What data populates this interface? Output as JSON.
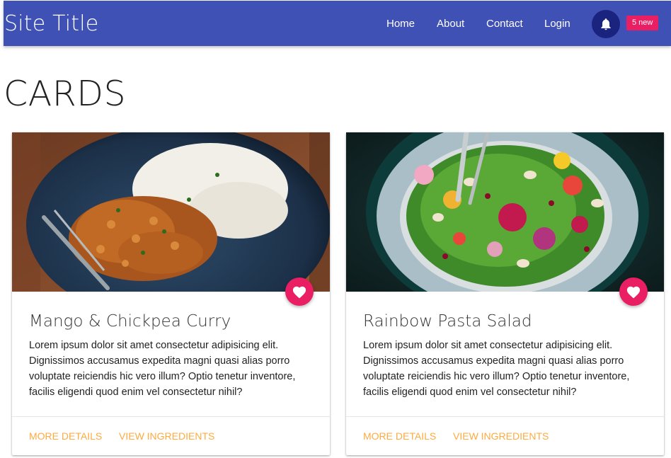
{
  "header": {
    "site_title": "Site Title",
    "nav": [
      {
        "label": "Home"
      },
      {
        "label": "About"
      },
      {
        "label": "Contact"
      },
      {
        "label": "Login"
      }
    ],
    "notification_icon": "bell-icon",
    "badge": "5 new"
  },
  "main": {
    "heading": "CARDS",
    "cards": [
      {
        "title": "Mango & Chickpea Curry",
        "text": "Lorem ipsum dolor sit amet consectetur adipisicing elit. Dignissimos accusamus expedita magni quasi alias porro voluptate reiciendis hic vero illum? Optio tenetur inventore, facilis eligendi quod enim vel consectetur nihil?",
        "fav_icon": "heart-icon",
        "actions": [
          "MORE DETAILS",
          "VIEW INGREDIENTS"
        ]
      },
      {
        "title": "Rainbow Pasta Salad",
        "text": "Lorem ipsum dolor sit amet consectetur adipisicing elit. Dignissimos accusamus expedita magni quasi alias porro voluptate reiciendis hic vero illum? Optio tenetur inventore, facilis eligendi quod enim vel consectetur nihil?",
        "fav_icon": "heart-icon",
        "actions": [
          "MORE DETAILS",
          "VIEW INGREDIENTS"
        ]
      }
    ]
  },
  "colors": {
    "primary": "#3f51b5",
    "primary_dark": "#1a237e",
    "accent": "#e91e63",
    "action_text": "#ffab40"
  }
}
